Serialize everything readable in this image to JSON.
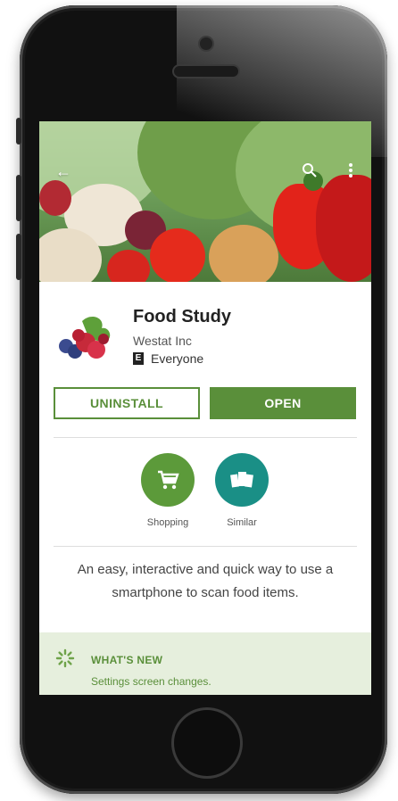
{
  "app": {
    "title": "Food Study",
    "developer": "Westat Inc",
    "content_rating": "Everyone",
    "esrb_glyph": "E"
  },
  "topbar": {
    "back_icon": "arrow-left-icon",
    "search_icon": "search-icon",
    "more_icon": "more-vert-icon"
  },
  "actions": {
    "uninstall_label": "UNINSTALL",
    "open_label": "OPEN"
  },
  "categories": [
    {
      "label": "Shopping",
      "icon": "shopping-cart-icon",
      "color": "#5c9a3a"
    },
    {
      "label": "Similar",
      "icon": "similar-cards-icon",
      "color": "#1a8f86"
    }
  ],
  "description": "An easy, interactive and quick way to use a smartphone to scan food items.",
  "whats_new": {
    "title": "WHAT'S NEW",
    "text": "Settings screen changes.",
    "icon": "loading-spinner-icon"
  },
  "colors": {
    "accent": "#5a8f3a",
    "whats_new_bg": "#e6efdd"
  }
}
